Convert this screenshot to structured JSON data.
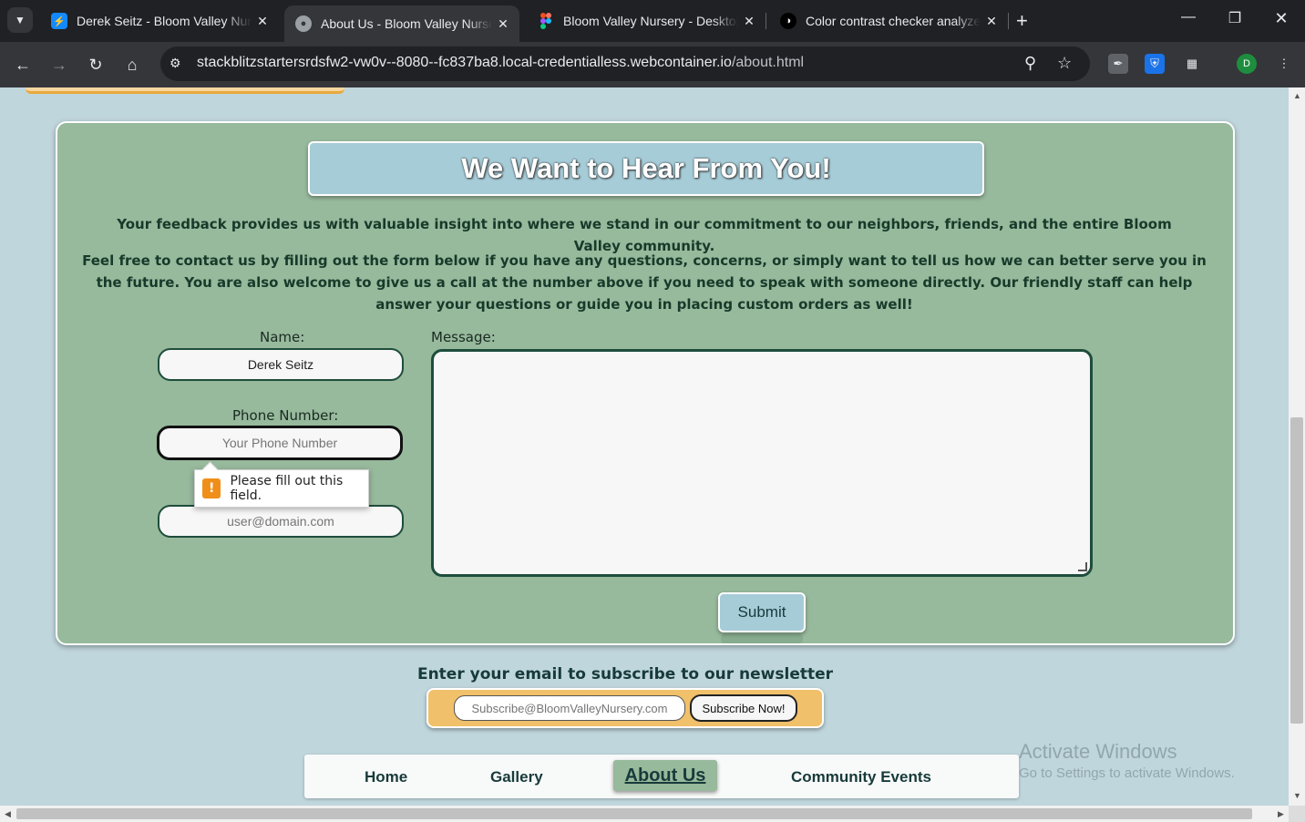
{
  "browser": {
    "tabs": [
      {
        "title": "Derek Seitz - Bloom Valley Nursery",
        "favicon": "bolt-icon"
      },
      {
        "title": "About Us - Bloom Valley Nursery",
        "favicon": "globe-icon",
        "active": true
      },
      {
        "title": "Bloom Valley Nursery - Desktop",
        "favicon": "figma-icon"
      },
      {
        "title": "Color contrast checker analyzer",
        "favicon": "contrast-icon"
      }
    ],
    "url_main": "stackblitzstartersrdsfw2-vw0v--8080--fc837ba8.local-credentialless.webcontainer.io",
    "url_path": "/about.html",
    "profile_initial": "D"
  },
  "contact": {
    "heading": "We Want to Hear From You!",
    "intro": "Your feedback provides us with valuable insight into where we stand in our commitment to our neighbors, friends, and the entire Bloom Valley community.",
    "details": "Feel free to contact us by filling out the form below if you have any questions, concerns, or simply want to tell us how we can better serve you in the future. You are also welcome to give us a call at the number above if you need to speak with someone directly. Our friendly staff can help answer your questions or guide you in placing custom orders as well!",
    "name_label": "Name:",
    "name_value": "Derek Seitz",
    "phone_label": "Phone Number:",
    "phone_placeholder": "Your Phone Number",
    "email_placeholder": "user@domain.com",
    "message_label": "Message:",
    "validation_message": "Please fill out this field.",
    "submit_label": "Submit"
  },
  "newsletter": {
    "title": "Enter your email to subscribe to our newsletter",
    "placeholder": "Subscribe@BloomValleyNursery.com",
    "button_label": "Subscribe Now!"
  },
  "nav": {
    "home": "Home",
    "gallery": "Gallery",
    "about": "About Us",
    "events": "Community Events"
  },
  "watermark": {
    "line1": "Activate Windows",
    "line2": "Go to Settings to activate Windows."
  },
  "colors": {
    "page_bg": "#bfd6dc",
    "panel_bg": "#97b99c",
    "heading_box": "#a6ccd8",
    "newsletter_bg": "#f0c06a",
    "text_dark": "#173a3a"
  }
}
